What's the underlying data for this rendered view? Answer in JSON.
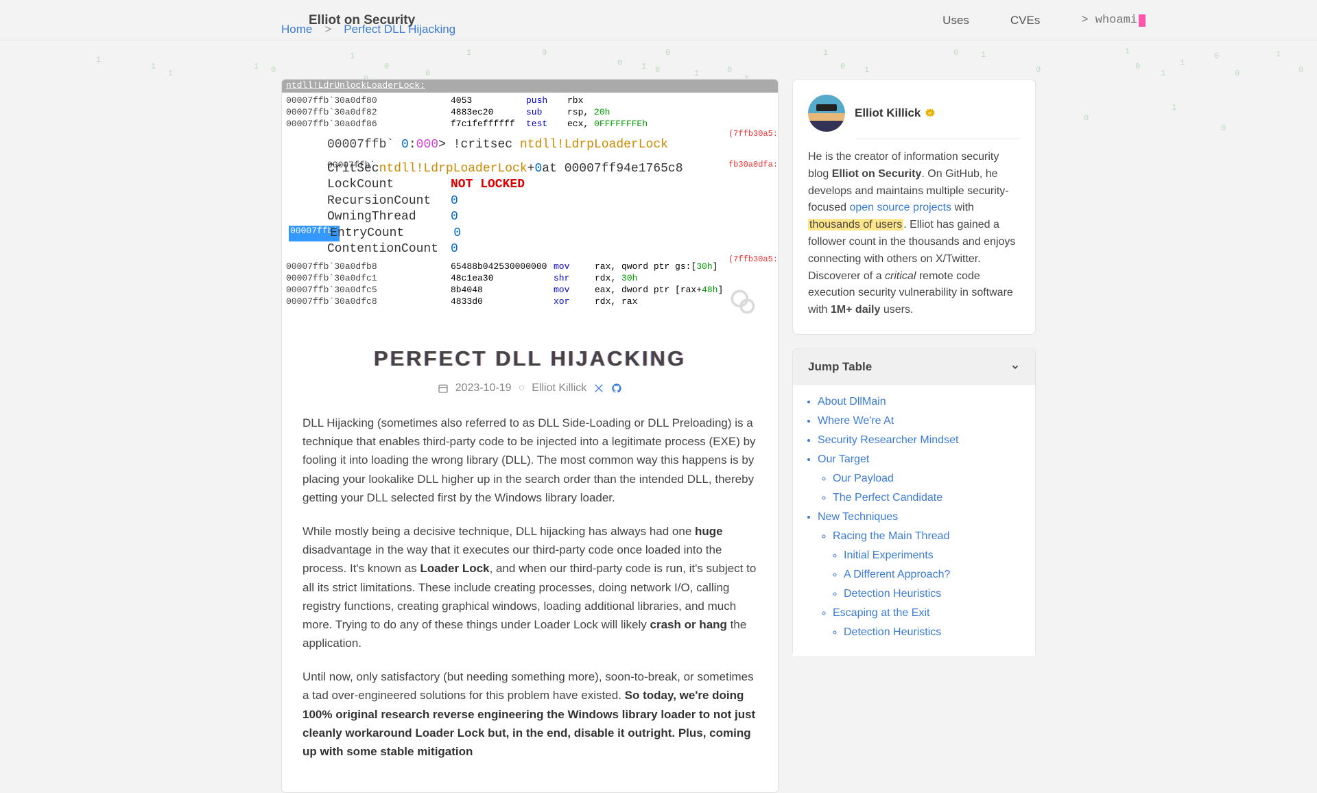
{
  "site": {
    "title": "Elliot on Security"
  },
  "nav": {
    "uses": "Uses",
    "cves": "CVEs",
    "whoami": "> whoami"
  },
  "breadcrumb": {
    "home": "Home",
    "sep": ">",
    "current": "Perfect DLL Hijacking"
  },
  "hero": {
    "header": "ntdll!LdrUnlockLoaderLock:",
    "lines": [
      {
        "addr": "00007ffb`30a0df80",
        "bytes": "4053",
        "mnem": "push",
        "op": "rbx"
      },
      {
        "addr": "00007ffb`30a0df82",
        "bytes": "4883ec20",
        "mnem": "sub",
        "op": "rsp, ",
        "suf": "20h"
      },
      {
        "addr": "00007ffb`30a0df86",
        "bytes": "f7c1feffffff",
        "mnem": "test",
        "op": "ecx, ",
        "suf": "0FFFFFFFEh"
      }
    ],
    "ann1": "(7ffb30a5:",
    "dbg_line": {
      "a": "0",
      "b": ":",
      "c": "000",
      "d": "> !critsec ",
      "e": "ntdll!LdrpLoaderLock"
    },
    "critsec_pre": "CritSec ",
    "critsec_name": "ntdll!LdrpLoaderLock",
    "critsec_op": "+",
    "critsec_zero": "0",
    "critsec_at": " at 00007ff94e1765c8",
    "stats": [
      {
        "label": "LockCount",
        "val": "NOT LOCKED",
        "bold": true
      },
      {
        "label": "RecursionCount",
        "val": "0"
      },
      {
        "label": "OwningThread",
        "val": "0"
      },
      {
        "label": "EntryCount",
        "val": "0",
        "hl": true
      },
      {
        "label": "ContentionCount",
        "val": "0"
      }
    ],
    "ann2": "fb30a0dfa:",
    "ann3": "(7ffb30a5:",
    "lines2": [
      {
        "addr": "00007ffb`30a0dfb8",
        "bytes": "65488b042530000000",
        "mnem": "mov",
        "op": "rax, qword ptr gs:[",
        "suf": "30h",
        "tail": "]"
      },
      {
        "addr": "00007ffb`30a0dfc1",
        "bytes": "48c1ea30",
        "mnem": "shr",
        "op": "rdx, ",
        "suf": "30h"
      },
      {
        "addr": "00007ffb`30a0dfc5",
        "bytes": "8b4048",
        "mnem": "mov",
        "op": "eax, dword ptr [rax+",
        "suf": "48h",
        "tail": "]"
      },
      {
        "addr": "00007ffb`30a0dfc8",
        "bytes": "4833d0",
        "mnem": "xor",
        "op": "rdx, rax"
      }
    ]
  },
  "article": {
    "title": "PERFECT DLL HIJACKING",
    "date": "2023-10-19",
    "author": "Elliot Killick",
    "p1": "DLL Hijacking (sometimes also referred to as DLL Side-Loading or DLL Preloading) is a technique that enables third-party code to be injected into a legitimate process (EXE) by fooling it into loading the wrong library (DLL). The most common way this happens is by placing your lookalike DLL higher up in the search order than the intended DLL, thereby getting your DLL selected first by the Windows library loader.",
    "p2a": "While mostly being a decisive technique, DLL hijacking has always had one ",
    "p2b": "huge",
    "p2c": " disadvantage in the way that it executes our third-party code once loaded into the process. It's known as ",
    "p2d": "Loader Lock",
    "p2e": ", and when our third-party code is run, it's subject to all its strict limitations. These include creating processes, doing network I/O, calling registry functions, creating graphical windows, loading additional libraries, and much more. Trying to do any of these things under Loader Lock will likely ",
    "p2f": "crash or hang",
    "p2g": " the application.",
    "p3a": "Until now, only satisfactory (but needing something more), soon-to-break, or sometimes a tad over-engineered solutions for this problem have existed. ",
    "p3b": "So today, we're doing 100% original research reverse engineering the Windows library loader to not just cleanly workaround Loader Lock but, in the end, disable it outright. Plus, coming up with some stable mitigation"
  },
  "bio": {
    "name": "Elliot Killick",
    "t1": "He is the creator of information security blog ",
    "t2": "Elliot on Security",
    "t3": ". On GitHub, he develops and maintains multiple security-focused ",
    "link": "open source projects",
    "t4": " with ",
    "hl": "thousands of users",
    "t5": ". Elliot has gained a follower count in the thousands and enjoys connecting with others on X/Twitter. Discoverer of a ",
    "t6": "critical",
    "t7": " remote code execution security vulnerability in software with ",
    "t8": "1M+ daily",
    "t9": " users."
  },
  "jump": {
    "title": "Jump Table",
    "items": {
      "i0": "About DllMain",
      "i1": "Where We're At",
      "i2": "Security Researcher Mindset",
      "i3": "Our Target",
      "i3a": "Our Payload",
      "i3b": "The Perfect Candidate",
      "i4": "New Techniques",
      "i4a": "Racing the Main Thread",
      "i4a1": "Initial Experiments",
      "i4a2": "A Different Approach?",
      "i4a3": "Detection Heuristics",
      "i4b": "Escaping at the Exit",
      "i4b1": "Detection Heuristics"
    }
  },
  "matrix": [
    "1",
    "0"
  ]
}
